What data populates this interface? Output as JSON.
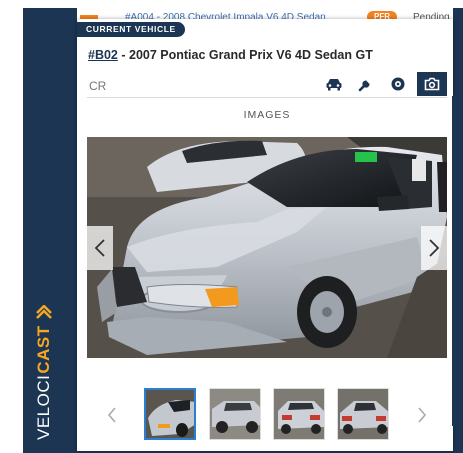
{
  "brand": {
    "part1": "VELOCI",
    "part2": "CAST"
  },
  "background_row": {
    "number": "#A004",
    "text": " - 2008 Chevrolet Impala V6 4D Sedan",
    "badge": "PFR",
    "status": "Pending"
  },
  "current_vehicle_label": "CURRENT VEHICLE",
  "vehicle": {
    "number": "#B02",
    "title": " - 2007 Pontiac Grand Prix V6 4D Sedan GT"
  },
  "cr_input": {
    "value": "",
    "placeholder": "CR"
  },
  "tabs": [
    {
      "icon": "car-icon",
      "active": false
    },
    {
      "icon": "wrench-icon",
      "active": false
    },
    {
      "icon": "tire-icon",
      "active": false
    },
    {
      "icon": "camera-icon",
      "active": true
    }
  ],
  "images_heading": "IMAGES",
  "gallery": {
    "selected_index": 0,
    "thumbnail_count": 4
  },
  "colors": {
    "navy": "#1b3553",
    "orange": "#f5a623",
    "thumb_highlight": "#2b7fd0"
  }
}
